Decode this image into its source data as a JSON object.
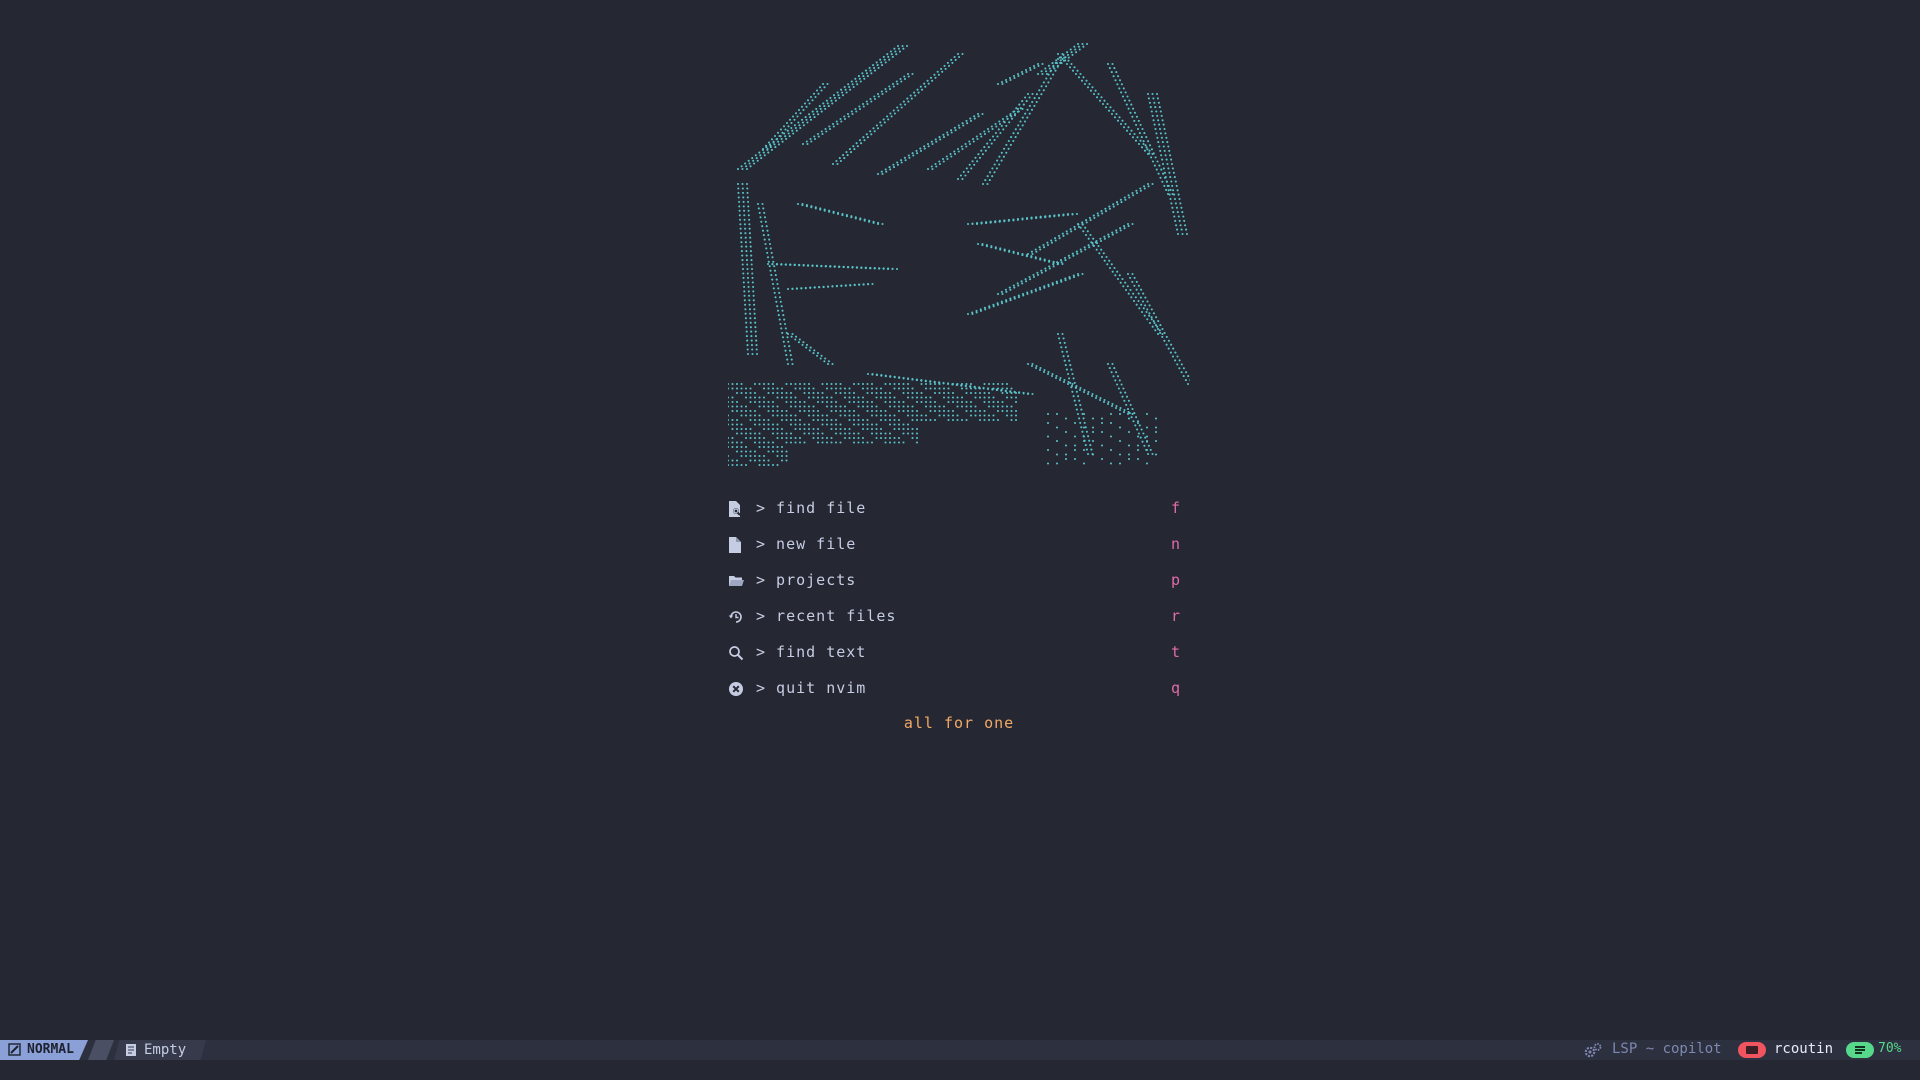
{
  "menu": {
    "items": [
      {
        "icon": "file-search-icon",
        "label": "> find file",
        "key": "f"
      },
      {
        "icon": "file-icon",
        "label": "> new file",
        "key": "n"
      },
      {
        "icon": "folder-icon",
        "label": "> projects",
        "key": "p"
      },
      {
        "icon": "history-icon",
        "label": "> recent files",
        "key": "r"
      },
      {
        "icon": "search-icon",
        "label": "> find text",
        "key": "t"
      },
      {
        "icon": "close-circle-icon",
        "label": "> quit nvim",
        "key": "q"
      }
    ]
  },
  "footer": {
    "text": "all for one"
  },
  "statusline": {
    "mode": "NORMAL",
    "file": "Empty",
    "lsp": "LSP ~ copilot",
    "user": "rcoutin",
    "percent": "70%"
  },
  "colors": {
    "background": "#252733",
    "art": "#59c2c6",
    "menu_text": "#c6cde3",
    "shortcut_key": "#e16caa",
    "footer": "#f2a965",
    "mode_bg": "#8aa0d6",
    "user_badge": "#f0545e",
    "percent": "#56d98a"
  }
}
